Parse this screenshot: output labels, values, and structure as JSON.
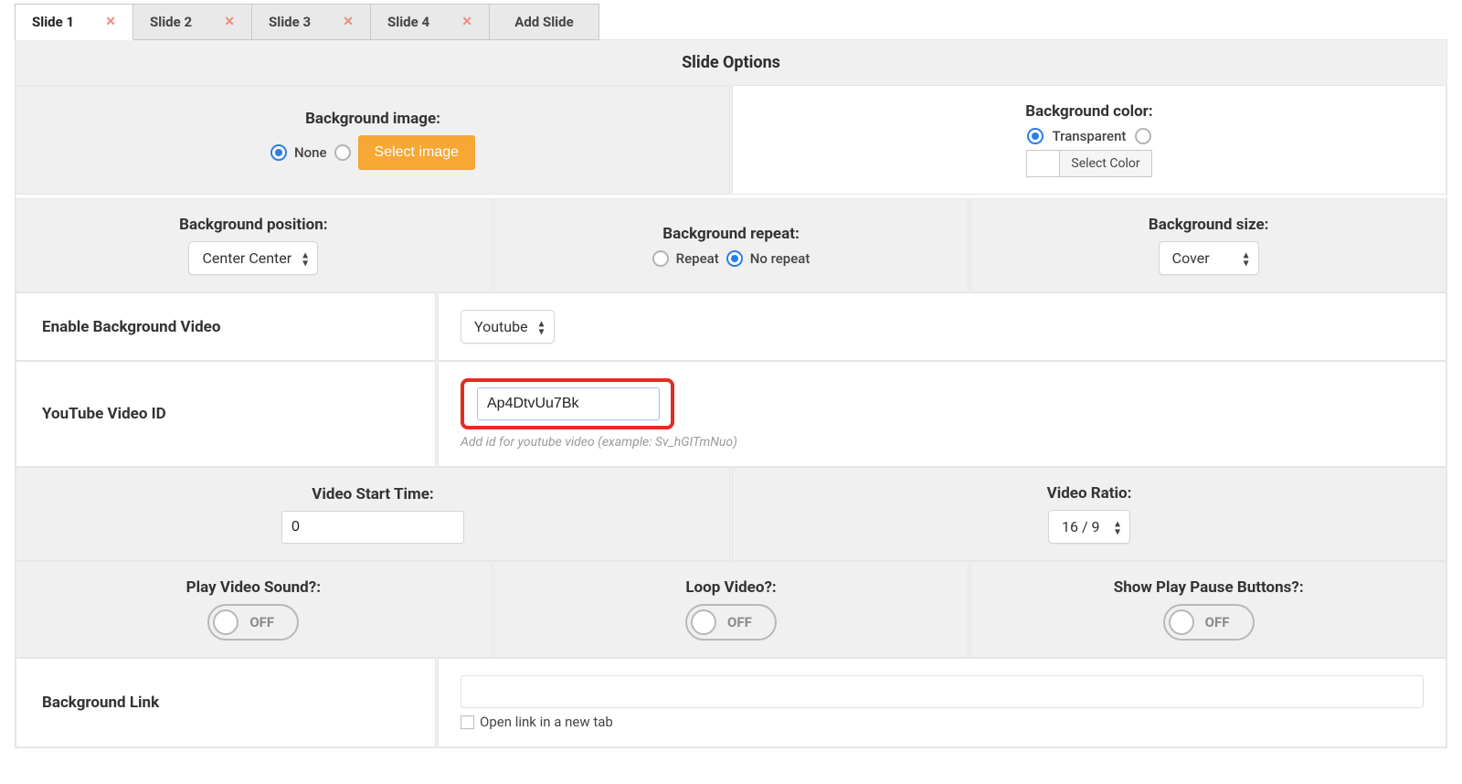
{
  "tabs": {
    "items": [
      {
        "label": "Slide 1",
        "active": true,
        "closable": true
      },
      {
        "label": "Slide 2",
        "active": false,
        "closable": true
      },
      {
        "label": "Slide 3",
        "active": false,
        "closable": true
      },
      {
        "label": "Slide 4",
        "active": false,
        "closable": true
      }
    ],
    "add_label": "Add Slide"
  },
  "panel_title": "Slide Options",
  "bg_image": {
    "heading": "Background image:",
    "none_label": "None",
    "select_btn": "Select image",
    "selected": "none"
  },
  "bg_color": {
    "heading": "Background color:",
    "transparent_label": "Transparent",
    "select_btn": "Select Color",
    "selected": "transparent"
  },
  "bg_position": {
    "heading": "Background position:",
    "value": "Center Center"
  },
  "bg_repeat": {
    "heading": "Background repeat:",
    "repeat_label": "Repeat",
    "norepeat_label": "No repeat",
    "selected": "norepeat"
  },
  "bg_size": {
    "heading": "Background size:",
    "value": "Cover"
  },
  "enable_video": {
    "heading": "Enable Background Video",
    "value": "Youtube"
  },
  "yt_id": {
    "heading": "YouTube Video ID",
    "value": "Ap4DtvUu7Bk",
    "hint": "Add id for youtube video (example: Sv_hGITmNuo)"
  },
  "start_time": {
    "heading": "Video Start Time:",
    "value": "0"
  },
  "ratio": {
    "heading": "Video Ratio:",
    "value": "16 / 9"
  },
  "sound": {
    "heading": "Play Video Sound?:",
    "state": "OFF"
  },
  "loop": {
    "heading": "Loop Video?:",
    "state": "OFF"
  },
  "playpause": {
    "heading": "Show Play Pause Buttons?:",
    "state": "OFF"
  },
  "bg_link": {
    "heading": "Background Link",
    "value": "",
    "checkbox_label": "Open link in a new tab",
    "checkbox_checked": false
  }
}
